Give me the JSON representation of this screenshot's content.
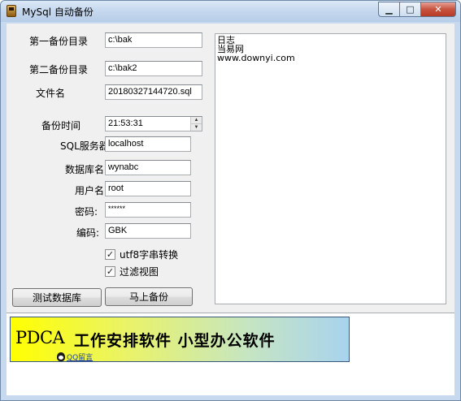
{
  "window": {
    "title": "MySql 自动备份",
    "minimize_glyph": "▁",
    "maximize_glyph": "□",
    "close_glyph": "✕"
  },
  "form": {
    "backup_dir1": {
      "label": "第一备份目录",
      "value": "c:\\bak"
    },
    "backup_dir2": {
      "label": "第二备份目录",
      "value": "c:\\bak2"
    },
    "file_name": {
      "label": "文件名",
      "value": "20180327144720.sql"
    },
    "backup_time": {
      "label": "备份时间",
      "value": "21:53:31"
    },
    "sql_server": {
      "label": "SQL服务器:",
      "value": "localhost"
    },
    "database": {
      "label": "数据库名:",
      "value": "wynabc"
    },
    "username": {
      "label": "用户名:",
      "value": "root"
    },
    "password": {
      "label": "密码:",
      "value": "******"
    },
    "encoding": {
      "label": "编码:",
      "value": "GBK"
    },
    "utf8_convert": {
      "label": "utf8字串转换",
      "checked": true
    },
    "filter_views": {
      "label": "过滤视图",
      "checked": true
    },
    "test_db_button": "测试数据库",
    "backup_now_button": "马上备份"
  },
  "log": {
    "lines": [
      "日志",
      "当易网",
      "www.downyi.com"
    ]
  },
  "ad": {
    "brand": "PDCA",
    "text": "工作安排软件  小型办公软件",
    "qq_link": "QQ留言"
  },
  "colors": {
    "banner_yellow": "#ffff00",
    "banner_blue": "#a8d3ee",
    "close_red": "#c7533f"
  },
  "icons": [
    "app-icon",
    "minimize-icon",
    "maximize-icon",
    "close-icon",
    "spin-up-icon",
    "spin-down-icon",
    "check-icon",
    "qq-icon"
  ]
}
